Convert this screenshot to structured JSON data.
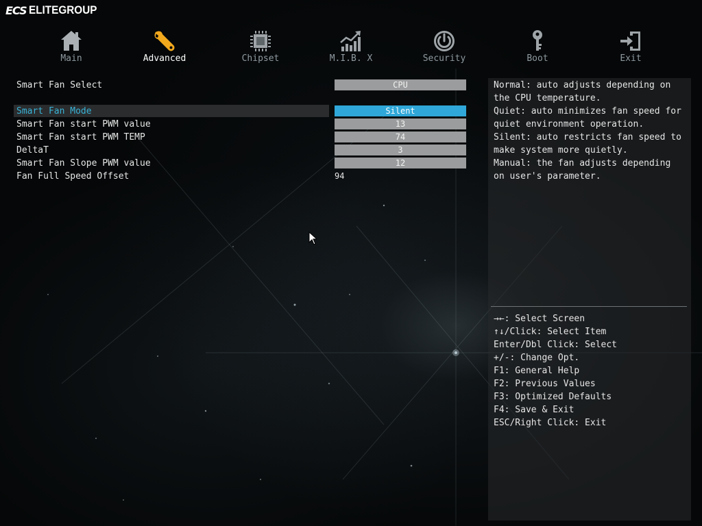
{
  "brand": {
    "mark": "ECS",
    "name": "ELITEGROUP"
  },
  "nav": {
    "tabs": [
      {
        "label": "Main",
        "icon": "home-icon",
        "active": false
      },
      {
        "label": "Advanced",
        "icon": "wrench-icon",
        "active": true
      },
      {
        "label": "Chipset",
        "icon": "chip-icon",
        "active": false
      },
      {
        "label": "M.I.B. X",
        "icon": "chart-icon",
        "active": false
      },
      {
        "label": "Security",
        "icon": "power-lock-icon",
        "active": false
      },
      {
        "label": "Boot",
        "icon": "key-icon",
        "active": false
      },
      {
        "label": "Exit",
        "icon": "exit-door-icon",
        "active": false
      }
    ]
  },
  "settings": {
    "smart_fan_select": {
      "label": "Smart Fan Select",
      "value": "CPU"
    },
    "smart_fan_mode": {
      "label": "Smart Fan Mode",
      "value": "Silent"
    },
    "start_pwm_value": {
      "label": "Smart Fan start PWM value",
      "value": "13"
    },
    "start_pwm_temp": {
      "label": "Smart Fan start PWM TEMP",
      "value": "74"
    },
    "delta_t": {
      "label": "DeltaT",
      "value": "3"
    },
    "slope_pwm_value": {
      "label": "Smart Fan Slope PWM value",
      "value": "12"
    },
    "full_speed_offset": {
      "label": "Fan Full Speed Offset",
      "value": "94"
    }
  },
  "help": {
    "description": "Normal: auto adjusts depending on\nthe CPU temperature.\nQuiet: auto minimizes fan speed for\nquiet environment operation.\nSilent: auto restricts fan speed to\nmake system more quietly.\nManual: the fan adjusts depending\non user's parameter.",
    "keys": [
      "→←: Select Screen",
      "↑↓/Click: Select Item",
      "Enter/Dbl Click: Select",
      "+/-: Change Opt.",
      "F1: General Help",
      "F2: Previous Values",
      "F3: Optimized Defaults",
      "F4: Save & Exit",
      "ESC/Right Click: Exit"
    ]
  },
  "colors": {
    "accent": "#2fa7d8",
    "selected_label": "#39b3d6",
    "value_box": "#9b9c9d",
    "inactive_tab": "#8f9aa0"
  }
}
